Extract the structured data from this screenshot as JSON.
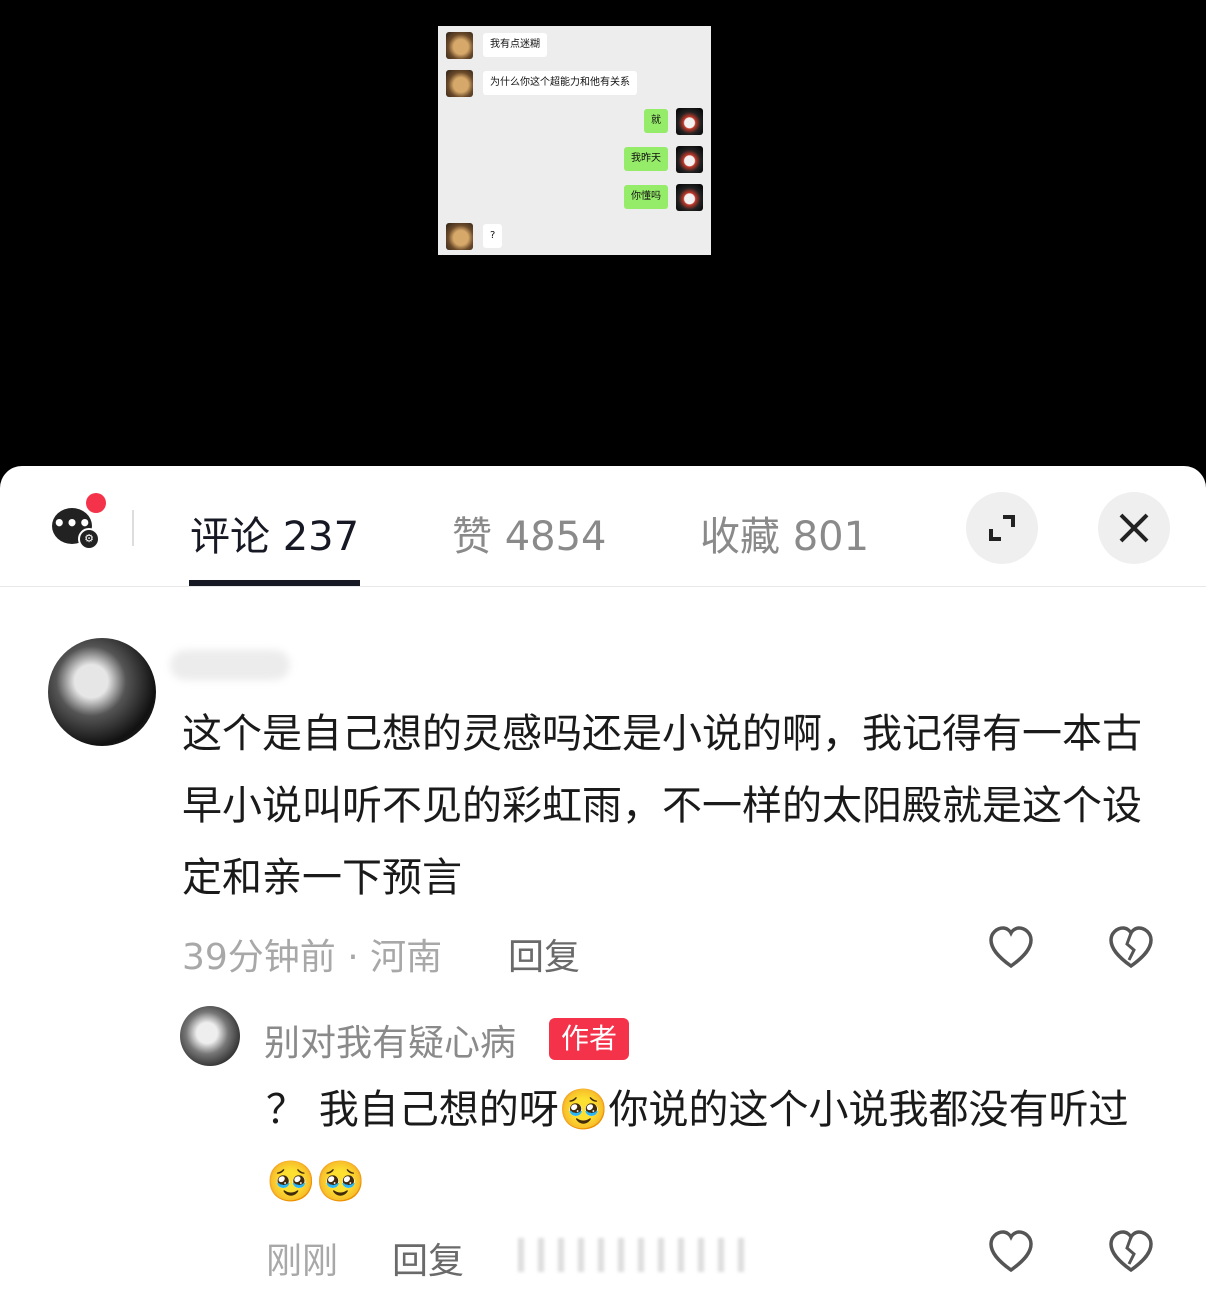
{
  "chat": {
    "messages": [
      {
        "side": "in",
        "text": "我有点迷糊"
      },
      {
        "side": "in",
        "text": "为什么你这个超能力和他有关系"
      },
      {
        "side": "out",
        "text": "就"
      },
      {
        "side": "out",
        "text": "我昨天"
      },
      {
        "side": "out",
        "text": "你懂吗"
      },
      {
        "side": "in",
        "text": "?"
      }
    ]
  },
  "tabs": [
    {
      "label": "评论 237"
    },
    {
      "label": "赞 4854"
    },
    {
      "label": "收藏 801"
    }
  ],
  "icons": {
    "messages": "chat-bubble-icon",
    "expand": "expand-icon",
    "close": "close-icon",
    "like": "heart-icon",
    "dislike": "broken-heart-icon"
  },
  "comment": {
    "text": "这个是自己想的灵感吗还是小说的啊，我记得有一本古早小说叫听不见的彩虹雨，不一样的太阳殿就是这个设定和亲一下预言",
    "meta": "39分钟前 · 河南",
    "reply_label": "回复"
  },
  "reply": {
    "author": "别对我有疑心病",
    "badge": "作者",
    "text_part1": "？ 我自己想的呀",
    "text_part2": "你说的这个小说我都没有听过",
    "emoji": "🥹",
    "meta": "刚刚",
    "reply_label": "回复"
  },
  "colors": {
    "accent": "#f4334b",
    "chat_out_bubble": "#95ec69",
    "chat_background": "#ededed"
  }
}
